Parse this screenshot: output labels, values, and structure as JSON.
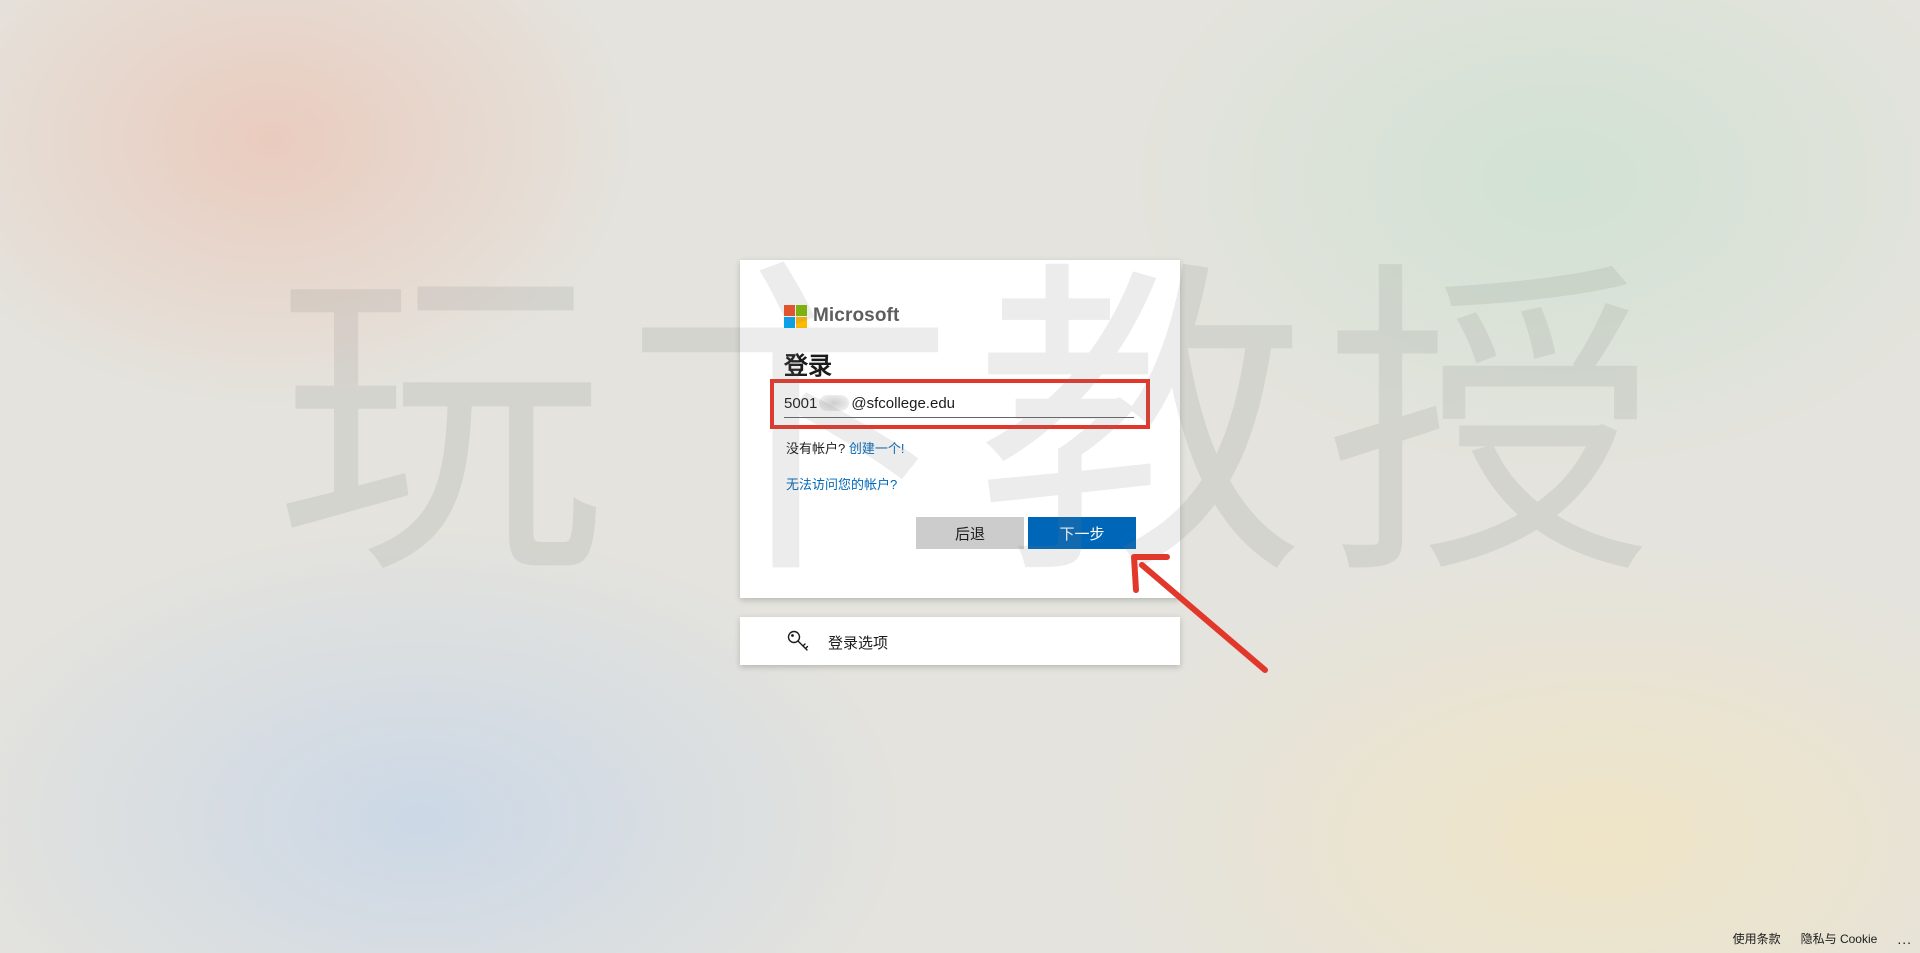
{
  "watermark": {
    "chars": [
      "玩",
      "卞",
      "教",
      "授"
    ]
  },
  "login_card": {
    "brand_name": "Microsoft",
    "brand_colors": [
      "#f25022",
      "#7fba00",
      "#00a4ef",
      "#ffb900"
    ],
    "title": "登录",
    "email": {
      "prefix": "5001",
      "suffix": "@sfcollege.edu"
    },
    "no_account_text": "没有帐户?",
    "create_link": "创建一个!",
    "cant_access_link": "无法访问您的帐户?",
    "back_button": "后退",
    "next_button": "下一步"
  },
  "options_card": {
    "icon": "key-icon",
    "label": "登录选项"
  },
  "footer": {
    "terms": "使用条款",
    "privacy": "隐私与 Cookie",
    "more": "..."
  },
  "colors": {
    "accent": "#0067b8",
    "highlight_box": "#e2382c",
    "arrow": "#e2382c"
  }
}
